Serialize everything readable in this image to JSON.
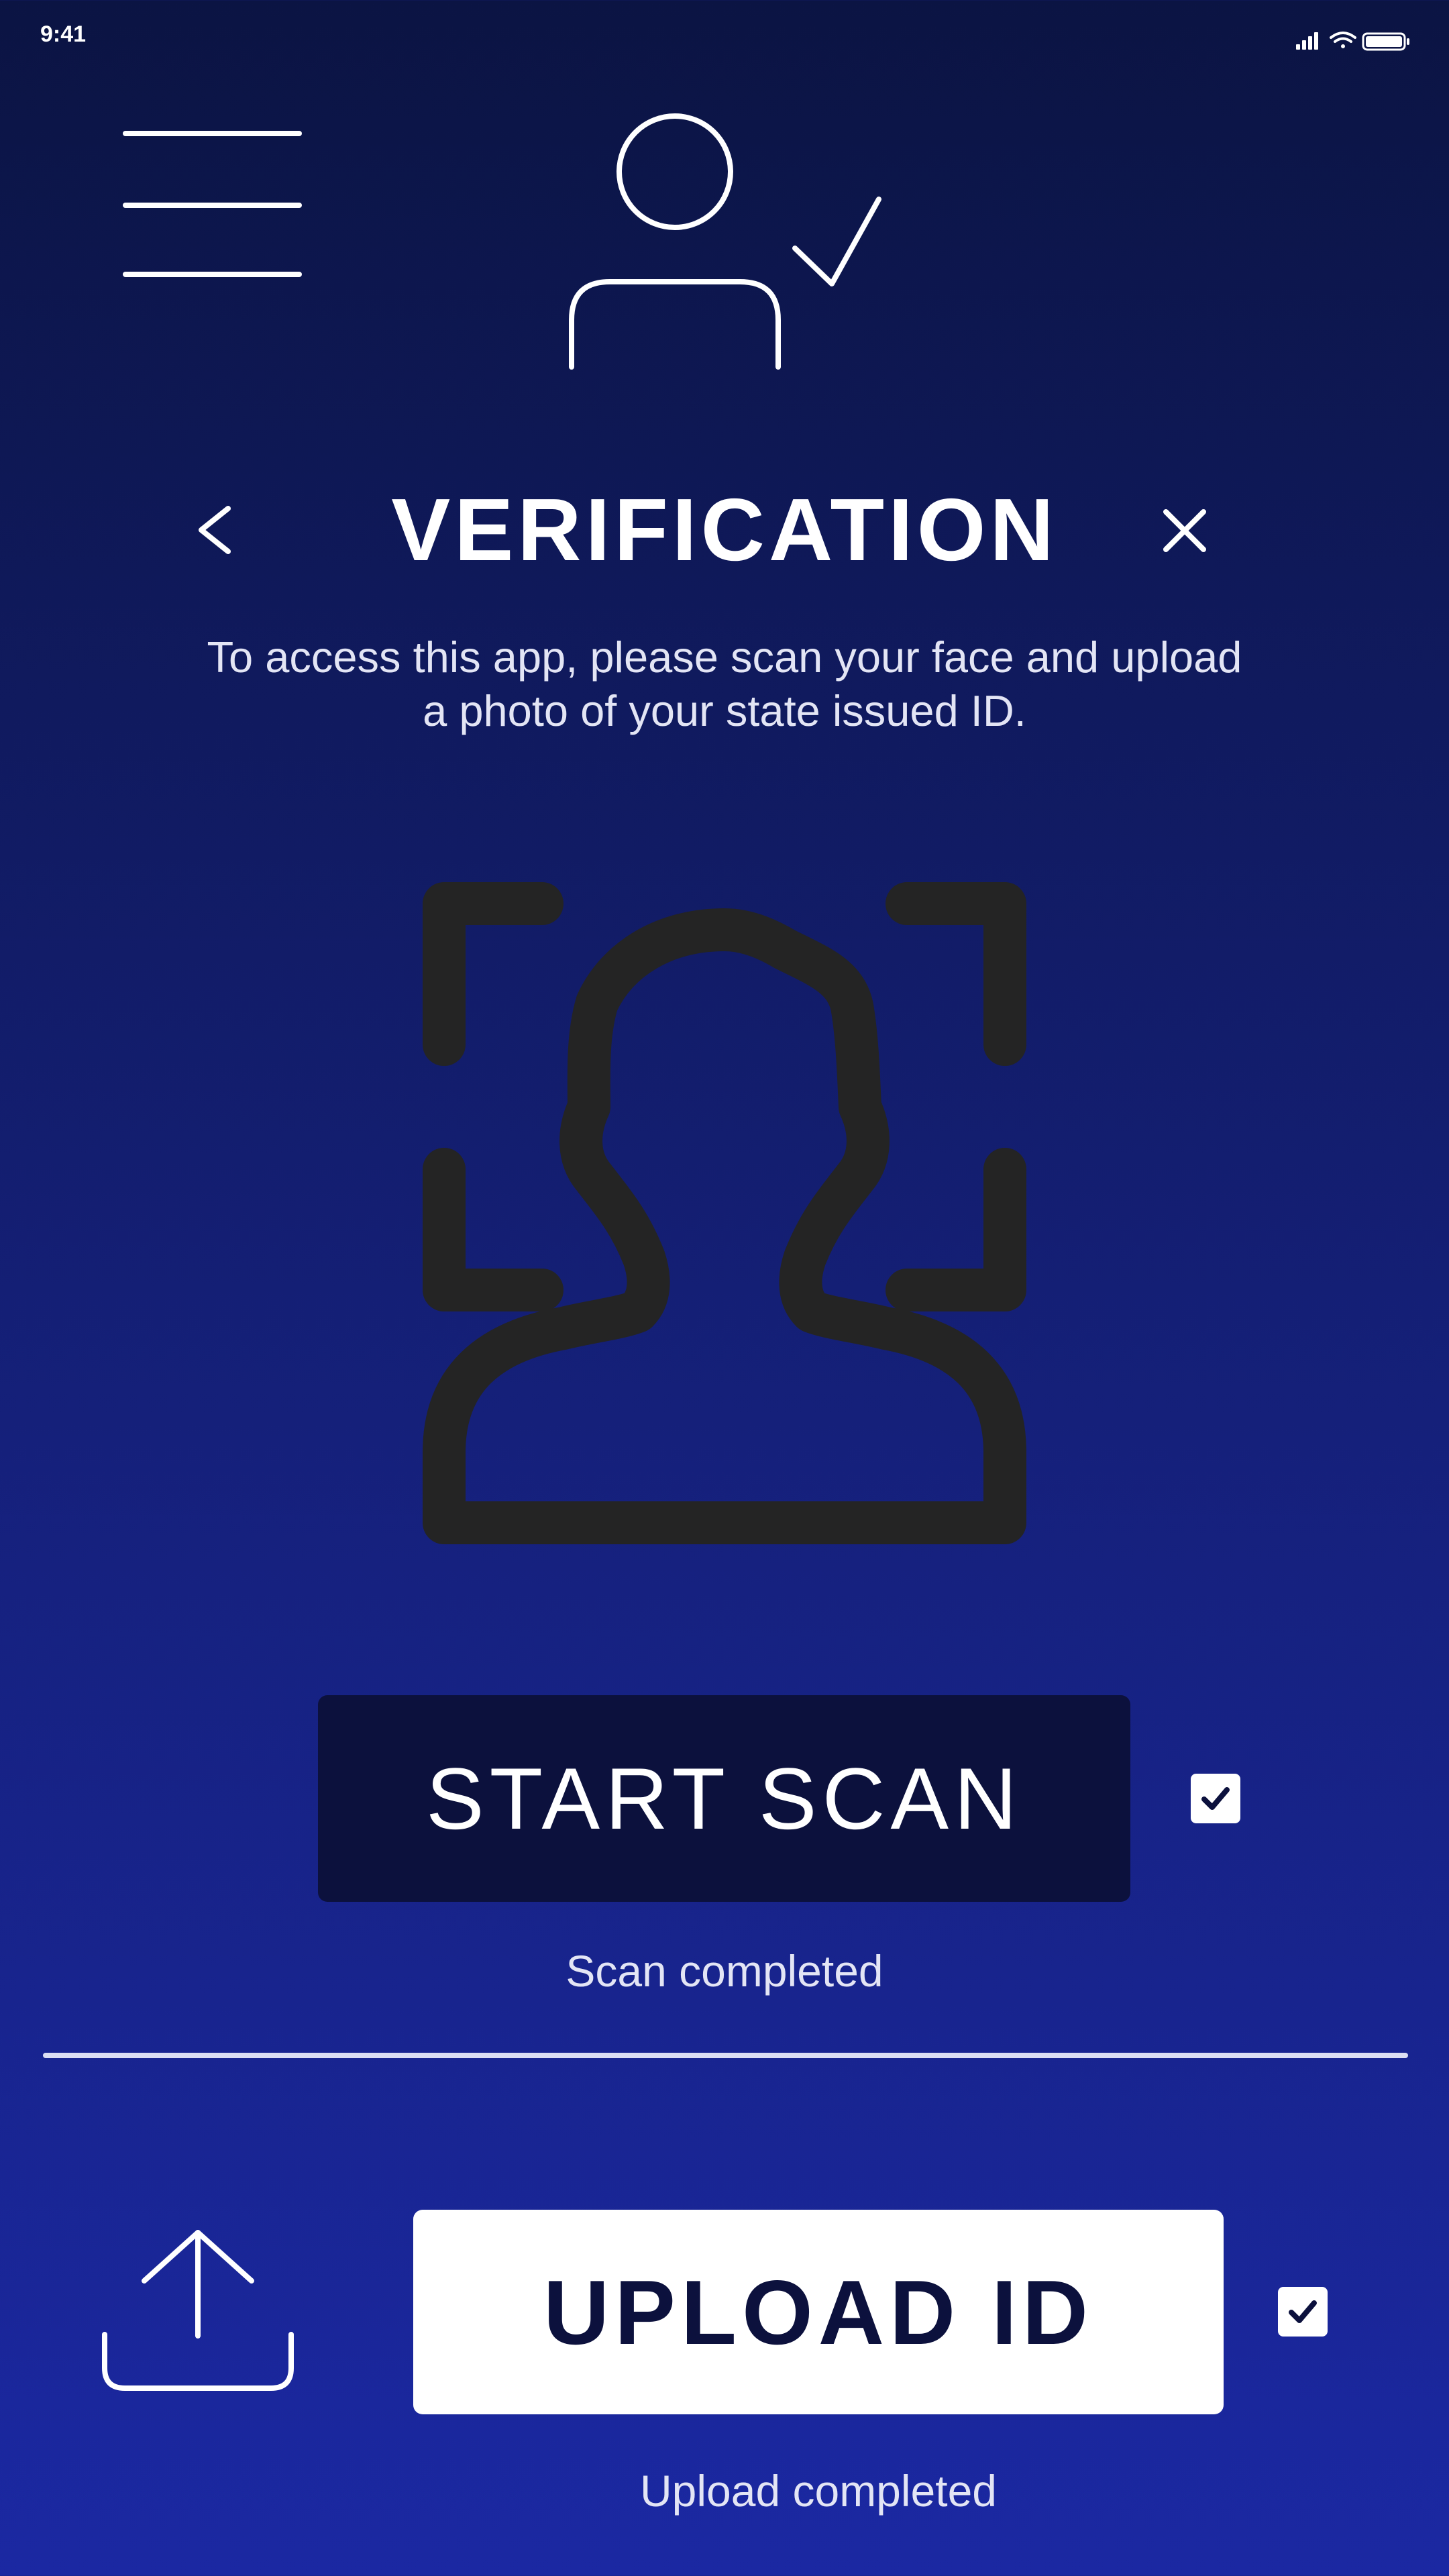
{
  "status_bar": {
    "time": "9:41"
  },
  "header": {
    "menu_icon": "hamburger-menu-icon",
    "avatar_icon": "user-check-icon",
    "title": "VERIFICATION",
    "back_icon": "chevron-left-icon",
    "close_icon": "close-icon"
  },
  "instructions": "To access this app, please scan your face and upload a photo of your state issued ID.",
  "face_scan": {
    "illustration_icon": "face-scan-icon",
    "button_label": "START SCAN",
    "checked": true,
    "status": "Scan completed"
  },
  "id_upload": {
    "icon": "upload-icon",
    "button_label": "UPLOAD ID",
    "checked": true,
    "status": "Upload completed"
  },
  "colors": {
    "background_top": "#0b1443",
    "background_bottom": "#1b28a2",
    "scan_button": "#0c113d",
    "illustration": "#242424",
    "upload_button": "#ffffff"
  }
}
